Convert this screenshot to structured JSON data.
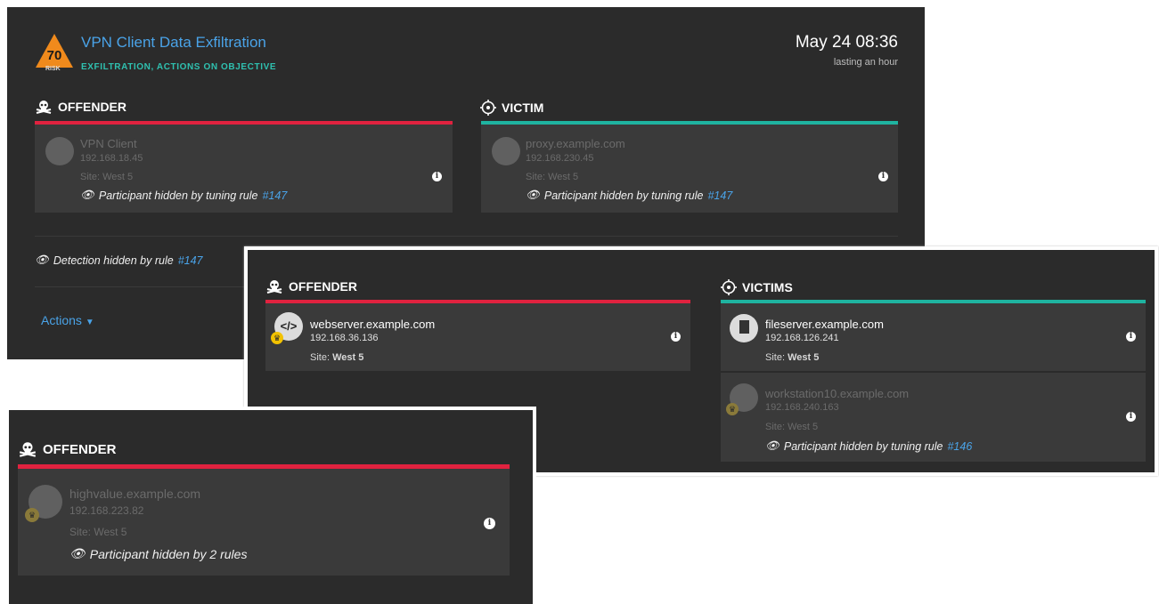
{
  "detection": {
    "risk": "70",
    "risk_label": "RISK",
    "title": "VPN Client Data Exfiltration",
    "categories": "EXFILTRATION, ACTIONS ON OBJECTIVE",
    "date": "May 24 08:36",
    "duration": "lasting an hour",
    "offender": {
      "heading": "OFFENDER",
      "host": "VPN Client",
      "ip": "192.168.18.45",
      "site_label": "Site:",
      "site": "West 5",
      "hidden_text": "Participant hidden by tuning rule",
      "rule": "#147"
    },
    "victim": {
      "heading": "VICTIM",
      "host": "proxy.example.com",
      "ip": "192.168.230.45",
      "site_label": "Site:",
      "site": "West 5",
      "hidden_text": "Participant hidden by tuning rule",
      "rule": "#147"
    },
    "detection_hidden_text": "Detection hidden by rule",
    "detection_rule": "#147",
    "actions_label": "Actions"
  },
  "panel2": {
    "offender_heading": "OFFENDER",
    "victims_heading": "VICTIMS",
    "offender": {
      "host": "webserver.example.com",
      "ip": "192.168.36.136",
      "site_label": "Site:",
      "site": "West 5"
    },
    "victims": [
      {
        "host": "fileserver.example.com",
        "ip": "192.168.126.241",
        "site_label": "Site:",
        "site": "West 5"
      },
      {
        "host": "workstation10.example.com",
        "ip": "192.168.240.163",
        "site_label": "Site:",
        "site": "West 5",
        "hidden_text": "Participant hidden by tuning rule",
        "rule": "#146"
      }
    ]
  },
  "panel3": {
    "offender_heading": "OFFENDER",
    "host": "highvalue.example.com",
    "ip": "192.168.223.82",
    "site_label": "Site:",
    "site": "West 5",
    "hidden_text": "Participant hidden by 2 rules"
  },
  "icons": {
    "info": "i",
    "crown": "♛"
  },
  "colors": {
    "offender": "#e0223f",
    "victim": "#1fb3a0",
    "link": "#4aa3e8",
    "risk": "#f08a1c"
  }
}
